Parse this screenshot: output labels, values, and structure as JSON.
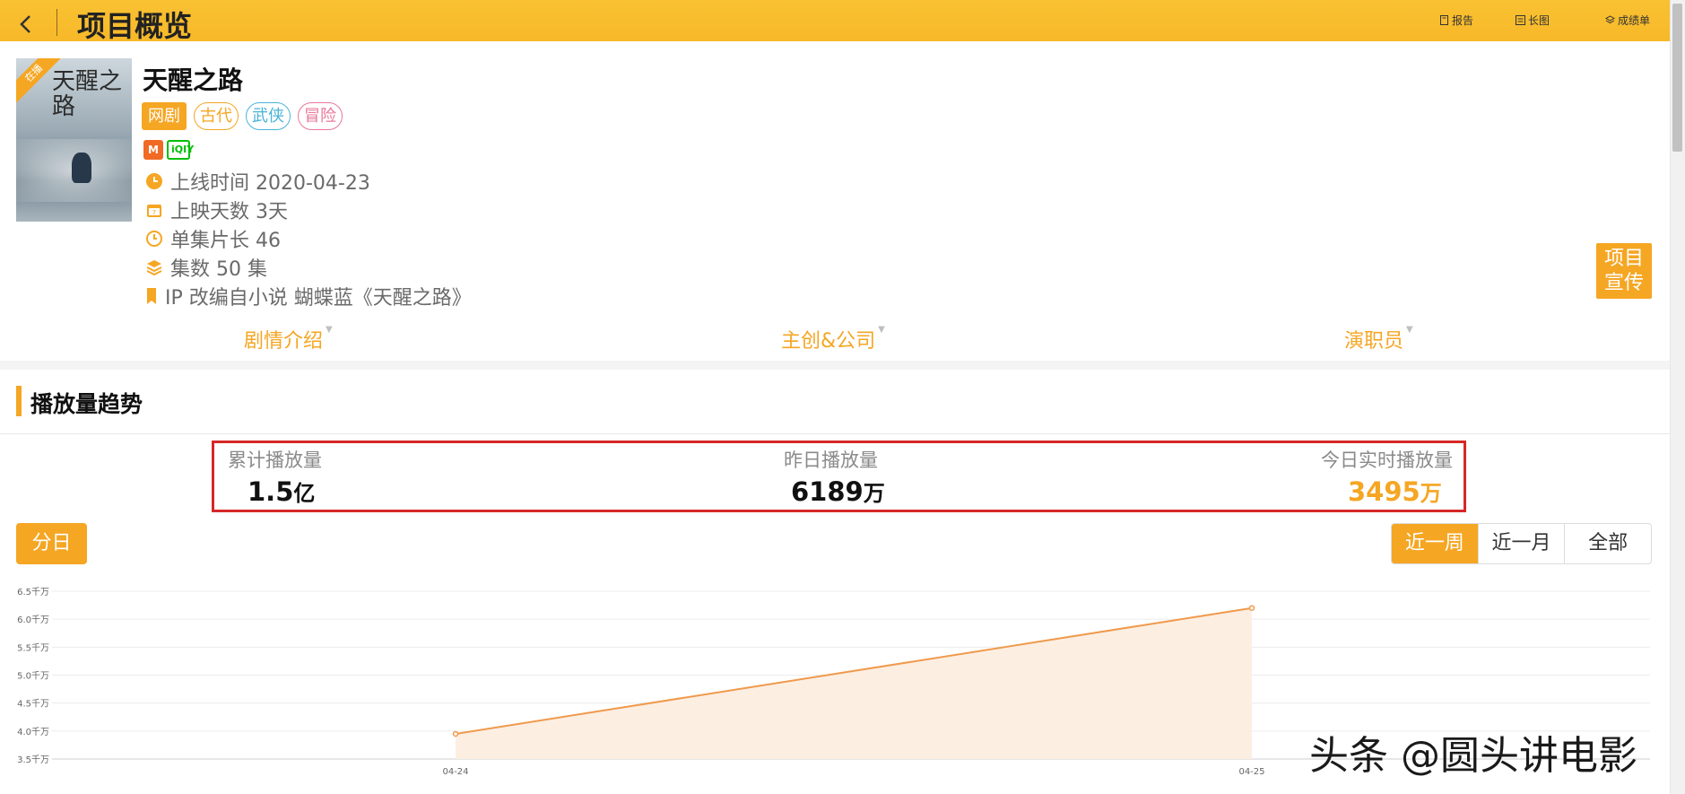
{
  "header": {
    "title": "项目概览",
    "tools": [
      {
        "label": "报告",
        "icon": "report-icon"
      },
      {
        "label": "长图",
        "icon": "long-image-icon"
      },
      {
        "label": "成绩单",
        "icon": "layers-icon"
      }
    ]
  },
  "project": {
    "poster_ribbon": "在播",
    "poster_title_art": "天醒之路",
    "name": "天醒之路",
    "primary_tag": "网剧",
    "tags": [
      {
        "label": "古代",
        "color": "#f5a623"
      },
      {
        "label": "武侠",
        "color": "#4ab3d8"
      },
      {
        "label": "冒险",
        "color": "#e8779a"
      }
    ],
    "platforms": [
      "M",
      "iQIY"
    ],
    "meta": [
      {
        "icon": "clock-icon",
        "text": "上线时间 2020-04-23"
      },
      {
        "icon": "calendar-icon",
        "text": "上映天数 3天"
      },
      {
        "icon": "timer-icon",
        "text": "单集片长 46"
      },
      {
        "icon": "stack-icon",
        "text": "集数 50 集"
      },
      {
        "icon": "bookmark-icon",
        "text": "IP 改编自小说 蝴蝶蓝《天醒之路》"
      }
    ],
    "promo_line1": "项目",
    "promo_line2": "宣传"
  },
  "subnav": [
    "剧情介绍",
    "主创&公司",
    "演职员"
  ],
  "trend": {
    "section_title": "播放量趋势",
    "stats": [
      {
        "label": "累计播放量",
        "value": "1.5",
        "unit": "亿"
      },
      {
        "label": "昨日播放量",
        "value": "6189",
        "unit": "万"
      },
      {
        "label": "今日实时播放量",
        "value": "3495",
        "unit": "万"
      }
    ],
    "daily_button": "分日",
    "ranges": [
      "近一周",
      "近一月",
      "全部"
    ]
  },
  "chart_data": {
    "type": "area",
    "x": [
      "04-24",
      "04-25"
    ],
    "series": [
      {
        "values": [
          3.95,
          6.2
        ]
      }
    ],
    "y_ticks": [
      "3.5千万",
      "4.0千万",
      "4.5千万",
      "5.0千万",
      "5.5千万",
      "6.0千万",
      "6.5千万"
    ],
    "ylim": [
      3.5,
      6.5
    ],
    "grid": true,
    "colors": {
      "line": "#ef9a4c",
      "fill": "#fdeee2"
    }
  },
  "watermark": "头条 @圆头讲电影",
  "colors": {
    "accent": "#f5a623",
    "header": "#f9c232",
    "highlight_box": "#d62828"
  }
}
